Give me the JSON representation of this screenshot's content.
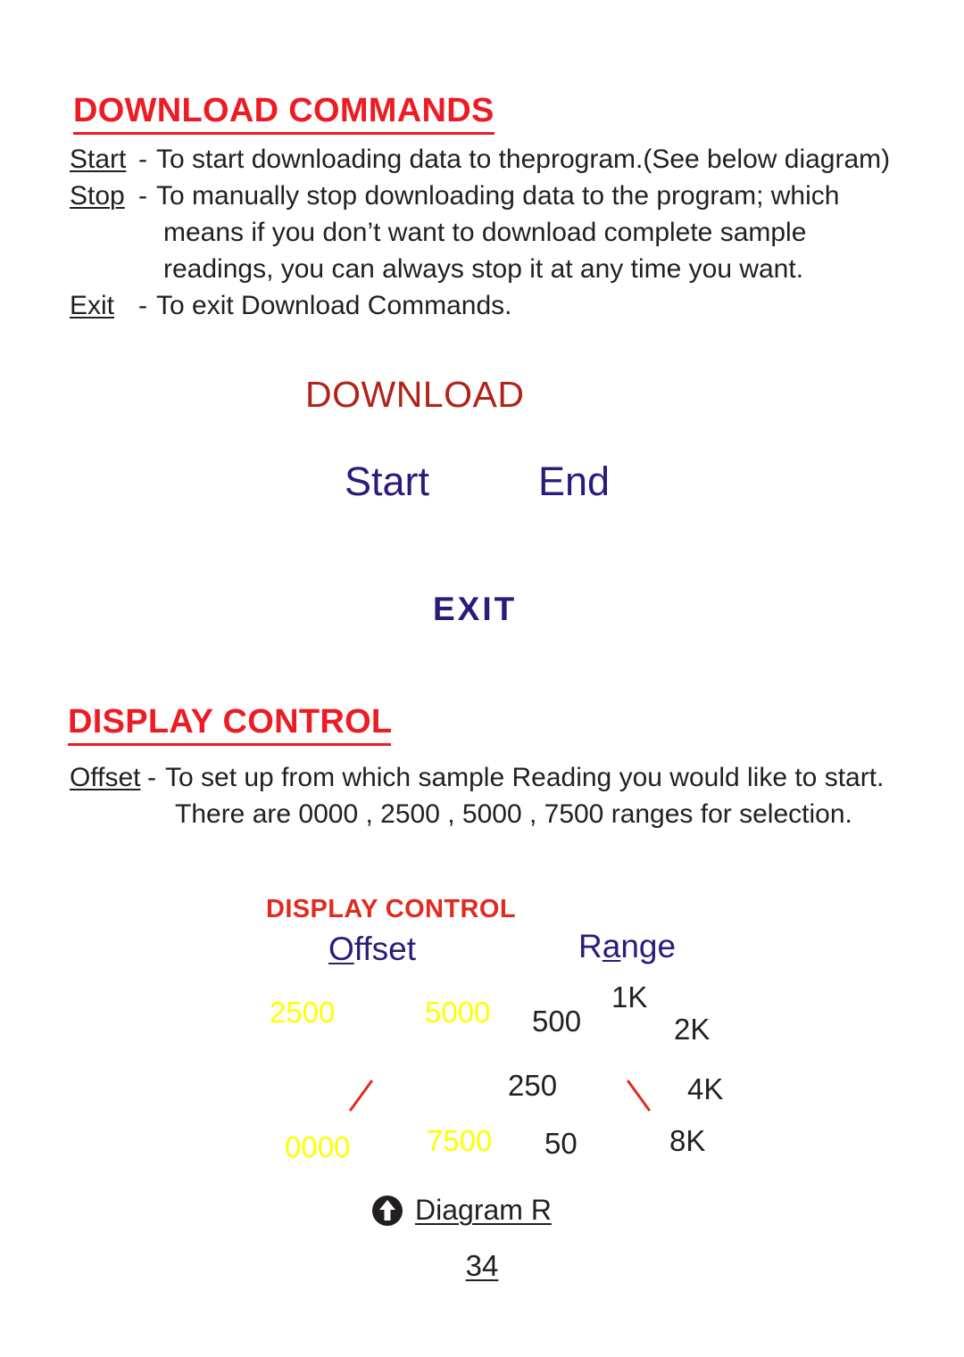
{
  "sections": {
    "download_commands": {
      "heading": "DOWNLOAD COMMANDS",
      "heading_color": "#ed1c24",
      "entries": [
        {
          "term": "Start",
          "dash": "-",
          "text": "To start downloading data to theprogram.(See below diagram)",
          "continuations": []
        },
        {
          "term": "Stop",
          "dash": "-",
          "text": "To manually  stop downloading  data to the program; which",
          "continuations": [
            "means if you don’t want to download complete sample",
            "readings, you can always stop it at any time you want."
          ]
        },
        {
          "term": "Exit",
          "dash": "-",
          "text": "To exit  Download Commands.",
          "continuations": []
        }
      ]
    },
    "display_control": {
      "heading": "DISPLAY CONTROL",
      "heading_color": "#ed1c24",
      "entries": [
        {
          "term": "Offset",
          "dash": "-",
          "text": "To set up from which sample Reading you would like to start.",
          "continuations": [
            "There are 0000 , 2500 , 5000 , 7500 ranges for selection."
          ]
        }
      ]
    }
  },
  "download_diagram": {
    "title": "DOWNLOAD",
    "title_color": "#b02318",
    "node_color": "#2e1a7a",
    "nodes": {
      "start": "Start",
      "end": "End",
      "exit": "EXIT"
    }
  },
  "display_control_diagram": {
    "title": "DISPLAY CONTROL",
    "title_color": "#e02b20",
    "column_label_color": "#2e1a7a",
    "offset_value_color": "#ffff00",
    "range_value_color": "#231f20",
    "tick_color": "#e02b20",
    "columns": {
      "offset": {
        "label_lead": "O",
        "label_rest": "ffset"
      },
      "range": {
        "label_lead": "R",
        "label_mid": "a",
        "label_rest": "nge"
      }
    },
    "offset_values": [
      "2500",
      "5000",
      "0000",
      "7500"
    ],
    "range_values": [
      "500",
      "1K",
      "2K",
      "250",
      "4K",
      "50",
      "8K"
    ]
  },
  "caption": {
    "icon": "arrow-up-circle-icon",
    "label": "Diagram R"
  },
  "page_number": "34"
}
